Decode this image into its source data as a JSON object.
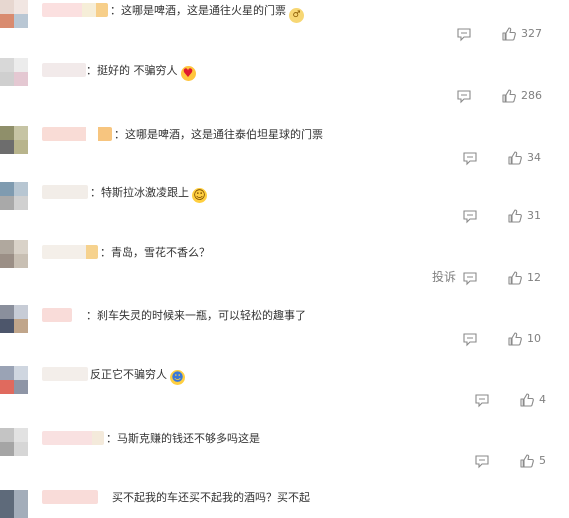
{
  "colors": {
    "text": "#333333",
    "meta": "#808080",
    "background": "#ffffff"
  },
  "icons": {
    "reply": "comment-bubble-icon",
    "like": "thumb-up-icon"
  },
  "report_label": "投诉",
  "comments": [
    {
      "text": "：这哪是啤酒，这是通往火星的门票",
      "emoji": "mars-emoji-icon",
      "likes": "327"
    },
    {
      "text": "：挺好的 不骗穷人",
      "emoji": "heart-eyes-emoji-icon",
      "likes": "286"
    },
    {
      "text": "：这哪是啤酒，这是通往泰伯坦星球的门票",
      "emoji": "",
      "likes": "34"
    },
    {
      "text": "：特斯拉冰激凌跟上",
      "emoji": "laughing-emoji-icon",
      "likes": "31"
    },
    {
      "text": "：青岛，雪花不香么？",
      "emoji": "",
      "likes": "12"
    },
    {
      "text": "：刹车失灵的时候来一瓶，可以轻松的趣事了",
      "emoji": "",
      "likes": "10"
    },
    {
      "text": "反正它不骗穷人",
      "emoji": "rolling-laugh-emoji-icon",
      "likes": "4"
    },
    {
      "text": "：马斯克赚的钱还不够多吗这是",
      "emoji": "",
      "likes": "5"
    },
    {
      "text": "买不起我的车还买不起我的酒吗？买不起",
      "emoji": "",
      "likes": ""
    }
  ]
}
